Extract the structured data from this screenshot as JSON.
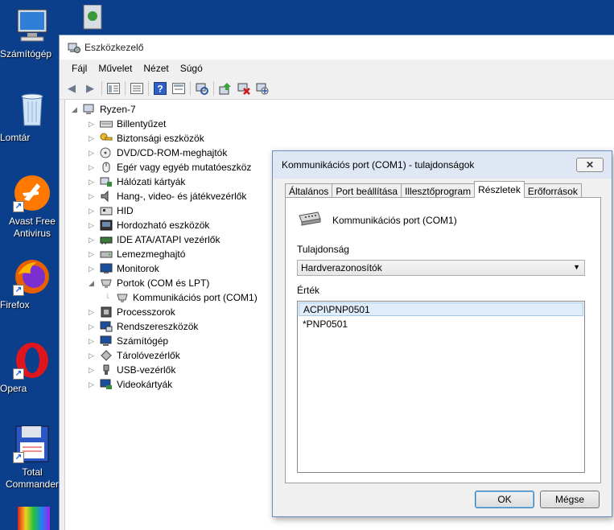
{
  "desktop": {
    "icons": [
      {
        "label": "Számítógép"
      },
      {
        "label": "Lomtár"
      },
      {
        "label": "Avast Free Antivirus"
      },
      {
        "label": "Firefox"
      },
      {
        "label": "Opera"
      },
      {
        "label": "Total Commander"
      }
    ]
  },
  "window": {
    "title": "Eszközkezelő",
    "menu": [
      "Fájl",
      "Művelet",
      "Nézet",
      "Súgó"
    ],
    "tree": {
      "root": "Ryzen-7",
      "items": [
        "Billentyűzet",
        "Biztonsági eszközök",
        "DVD/CD-ROM-meghajtók",
        "Egér vagy egyéb mutatóeszköz",
        "Hálózati kártyák",
        "Hang-, video- és játékvezérlők",
        "HID",
        "Hordozható eszközök",
        "IDE ATA/ATAPI vezérlők",
        "Lemezmeghajtó",
        "Monitorok",
        "Portok (COM és LPT)",
        "Kommunikációs port (COM1)",
        "Processzorok",
        "Rendszereszközök",
        "Számítógép",
        "Tárolóvezérlők",
        "USB-vezérlők",
        "Videokártyák"
      ]
    }
  },
  "dialog": {
    "title": "Kommunikációs port (COM1) - tulajdonságok",
    "close": "✕",
    "tabs": [
      "Általános",
      "Port beállítása",
      "Illesztőprogram",
      "Részletek",
      "Erőforrások"
    ],
    "active_tab": "Részletek",
    "device_name": "Kommunikációs port (COM1)",
    "property_label": "Tulajdonság",
    "property_value": "Hardverazonosítók",
    "value_label": "Érték",
    "values": [
      "ACPI\\PNP0501",
      "*PNP0501"
    ],
    "ok": "OK",
    "cancel": "Mégse"
  }
}
